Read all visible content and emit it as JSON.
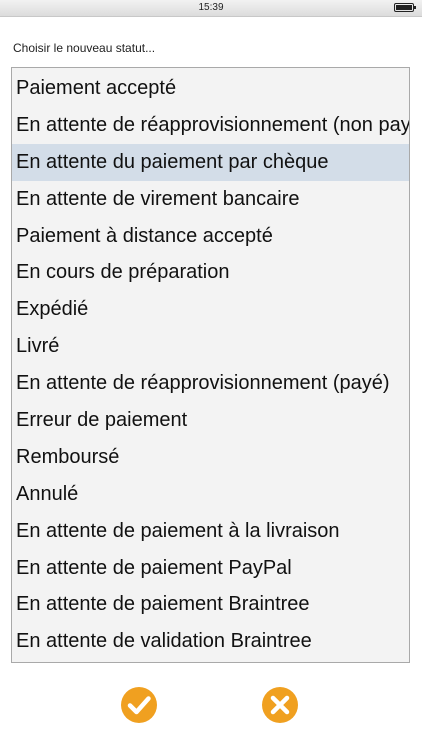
{
  "status_bar": {
    "time": "15:39"
  },
  "prompt": "Choisir le nouveau statut...",
  "statuses": [
    {
      "label": "Paiement accepté",
      "selected": false
    },
    {
      "label": "En attente de réapprovisionnement (non payé)",
      "selected": false
    },
    {
      "label": "En attente du paiement par chèque",
      "selected": true
    },
    {
      "label": "En attente de virement bancaire",
      "selected": false
    },
    {
      "label": "Paiement à distance accepté",
      "selected": false
    },
    {
      "label": "En cours de préparation",
      "selected": false
    },
    {
      "label": "Expédié",
      "selected": false
    },
    {
      "label": "Livré",
      "selected": false
    },
    {
      "label": "En attente de réapprovisionnement (payé)",
      "selected": false
    },
    {
      "label": "Erreur de paiement",
      "selected": false
    },
    {
      "label": "Remboursé",
      "selected": false
    },
    {
      "label": "Annulé",
      "selected": false
    },
    {
      "label": "En attente de paiement à la livraison",
      "selected": false
    },
    {
      "label": "En attente de paiement PayPal",
      "selected": false
    },
    {
      "label": "En attente de paiement Braintree",
      "selected": false
    },
    {
      "label": "En attente de validation Braintree",
      "selected": false
    }
  ],
  "actions": {
    "confirm_icon": "check-icon",
    "cancel_icon": "close-icon",
    "accent_color": "#f0a020"
  },
  "colors": {
    "selected_row": "#d3dde8",
    "list_background": "#f3f3f3"
  }
}
